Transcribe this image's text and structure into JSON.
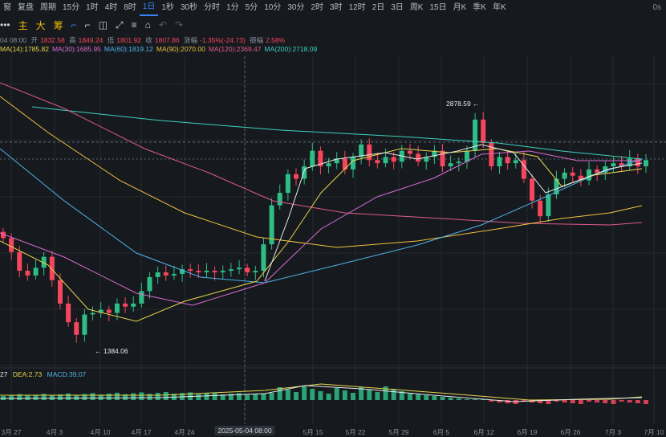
{
  "toolbar": {
    "items": [
      "窗",
      "复盘",
      "周期",
      "15分",
      "1时",
      "4时",
      "8时",
      "1日",
      "1秒",
      "30秒",
      "分时",
      "1分",
      "5分",
      "10分",
      "30分",
      "2时",
      "3时",
      "12时",
      "2日",
      "3日",
      "周K",
      "15日",
      "月K",
      "季K",
      "年K"
    ],
    "active": "1日",
    "corner": "0s"
  },
  "tools": {
    "items": [
      "•••",
      "主",
      "大",
      "筹",
      "⌐",
      "⌐",
      "◫",
      "⤢",
      "≡",
      "⌂",
      "↶",
      "↷"
    ]
  },
  "ohlc": {
    "date": "04 08:00",
    "open_label": "开",
    "open": "1832.58",
    "high_label": "高",
    "high": "1849.24",
    "low_label": "低",
    "low": "1801.92",
    "close_label": "收",
    "close": "1807.86",
    "change_label": "涨幅",
    "change": "-1.35%(-24.73)",
    "amp_label": "振幅",
    "amp": "2.58%"
  },
  "ma_legend": [
    {
      "text": "MA(14):1785.82",
      "color": "#e8d44d"
    },
    {
      "text": "MA(30):1685.95",
      "color": "#d86bd0"
    },
    {
      "text": "MA(60):1819.12",
      "color": "#4fb3e8"
    },
    {
      "text": "MA(90):2070.00",
      "color": "#f0c040"
    },
    {
      "text": "MA(120):2369.47",
      "color": "#e05a8a"
    },
    {
      "text": "MA(200):2718.09",
      "color": "#3fd0c0"
    }
  ],
  "annotations": {
    "high": "2878.59 ←",
    "low": "← 1384.06"
  },
  "macd": {
    "dif": "27",
    "dif_color": "#e8e8e8",
    "dea": "DEA:2.73",
    "dea_color": "#e8d44d",
    "macd": "MACD:39.07",
    "macd_color": "#4fb3e8"
  },
  "x_axis": [
    "3月 27",
    "4月 3",
    "4月 10",
    "4月 17",
    "4月 24",
    "2025-05-04 08:00",
    "5月 15",
    "5月 22",
    "5月 29",
    "6月 5",
    "6月 12",
    "6月 19",
    "6月 26",
    "7月 3",
    "7月 10"
  ],
  "colors": {
    "up": "#2ebd85",
    "down": "#f6465d",
    "bg": "#161a1e",
    "grid": "#262a30"
  },
  "chart_data": {
    "type": "candlestick",
    "ohlc_close": [
      2040,
      1950,
      1830,
      1800,
      1850,
      1920,
      1770,
      1620,
      1500,
      1420,
      1550,
      1560,
      1580,
      1560,
      1620,
      1600,
      1620,
      1700,
      1790,
      1820,
      1800,
      1810,
      1840,
      1830,
      1820,
      1830,
      1820,
      1830,
      1840,
      1850,
      1820,
      1830,
      2000,
      2250,
      2330,
      2450,
      2420,
      2500,
      2600,
      2500,
      2520,
      2550,
      2480,
      2560,
      2640,
      2540,
      2520,
      2560,
      2530,
      2600,
      2580,
      2530,
      2560,
      2600,
      2500,
      2520,
      2530,
      2600,
      2800,
      2650,
      2500,
      2560,
      2520,
      2540,
      2420,
      2280,
      2180,
      2320,
      2420,
      2460,
      2440,
      2410,
      2480,
      2460,
      2500,
      2520,
      2500,
      2550,
      2500,
      2540
    ],
    "annotations": [
      {
        "label": "2878.59",
        "type": "high"
      },
      {
        "label": "1384.06",
        "type": "low"
      }
    ]
  }
}
